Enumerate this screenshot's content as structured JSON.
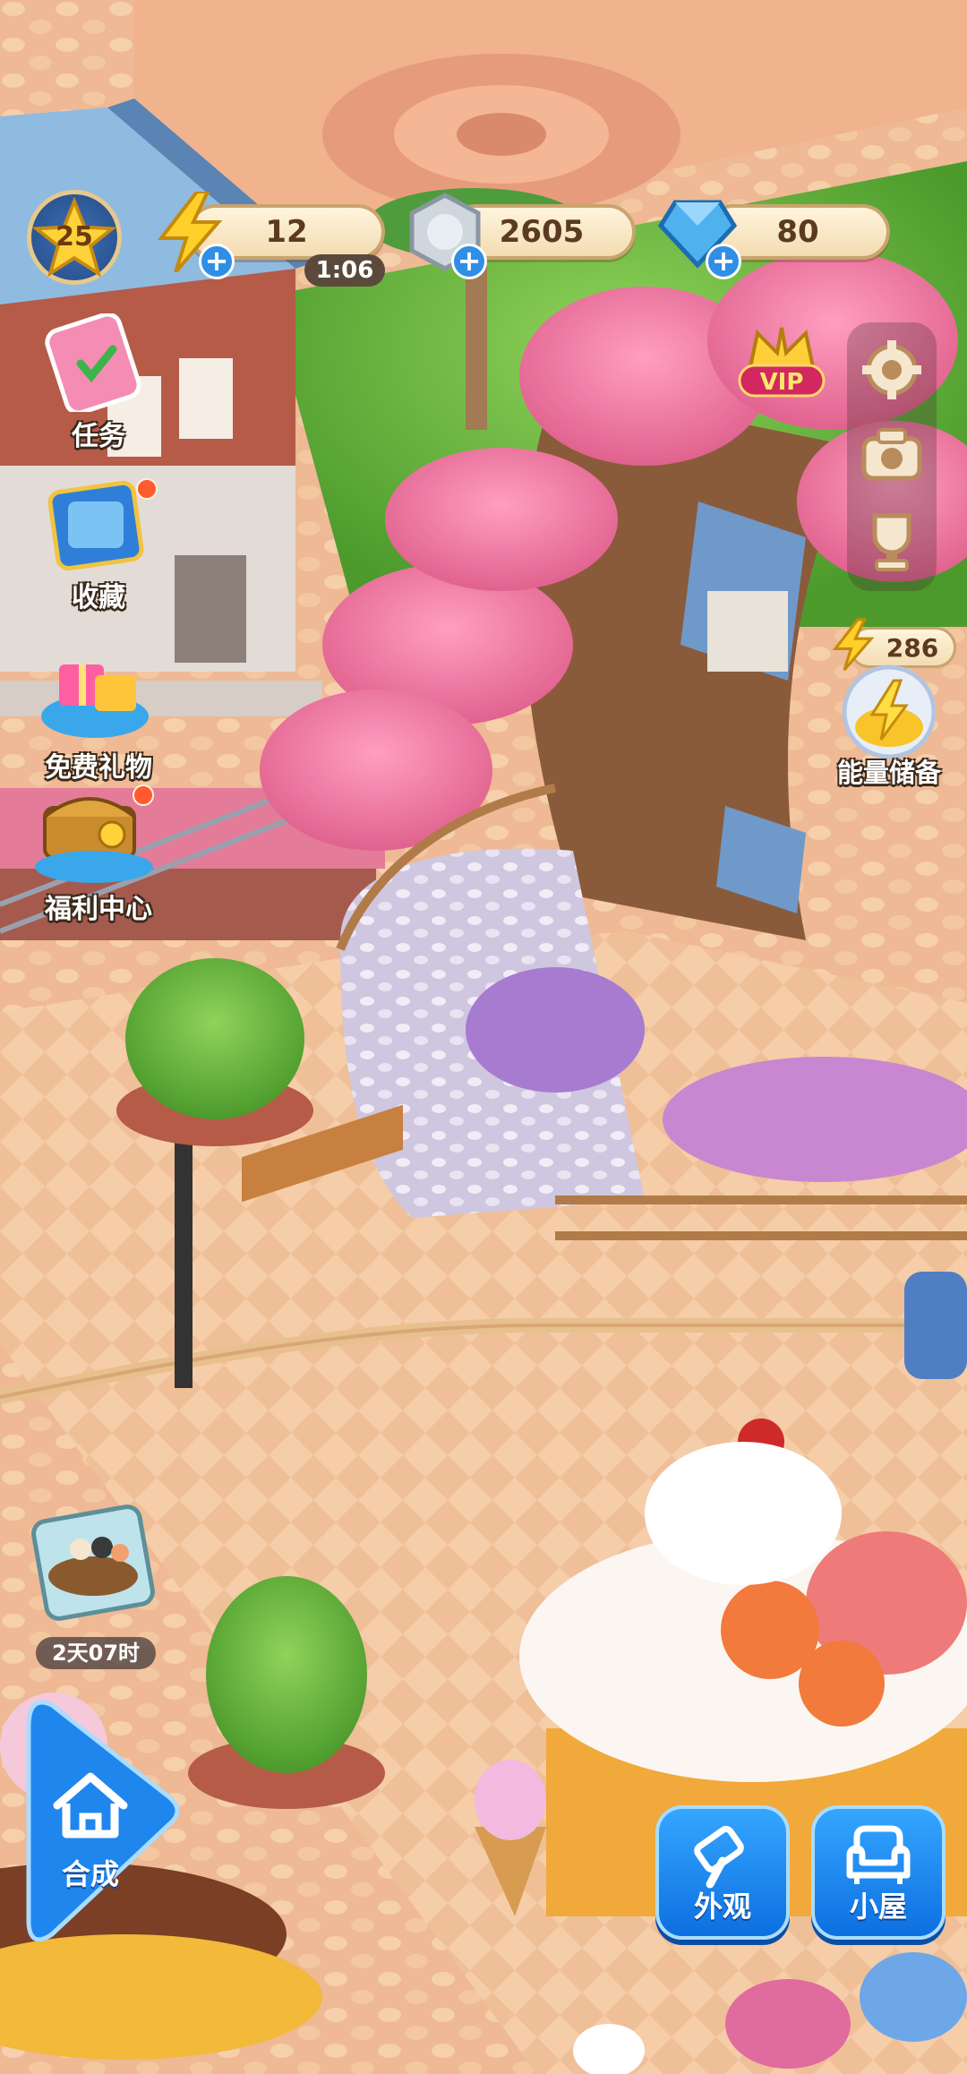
{
  "hud": {
    "level": "25",
    "energy": {
      "value": "12",
      "timer": "1:06"
    },
    "coins": {
      "value": "2605"
    },
    "gems": {
      "value": "80"
    }
  },
  "left_menu": [
    {
      "key": "tasks",
      "label": "任务",
      "notify": false
    },
    {
      "key": "collection",
      "label": "收藏",
      "notify": true
    },
    {
      "key": "free_gift",
      "label": "免费礼物",
      "notify": false
    },
    {
      "key": "welfare",
      "label": "福利中心",
      "notify": true
    }
  ],
  "right_menu": {
    "vip_label": "VIP",
    "settings_icon": "gear-icon",
    "camera_icon": "camera-icon",
    "trophy_icon": "trophy-icon",
    "energy_reserve": {
      "value": "286",
      "label": "能量储备"
    }
  },
  "event": {
    "timer": "2天07时"
  },
  "bottom": {
    "merge_label": "合成",
    "appearance_label": "外观",
    "house_label": "小屋"
  },
  "colors": {
    "ground": "#eab894",
    "path": "#f2c9a2",
    "grass": "#7fc14a",
    "blossom": "#f47aa6",
    "button_blue": "#1f86ee",
    "gold": "#f7c52a"
  }
}
